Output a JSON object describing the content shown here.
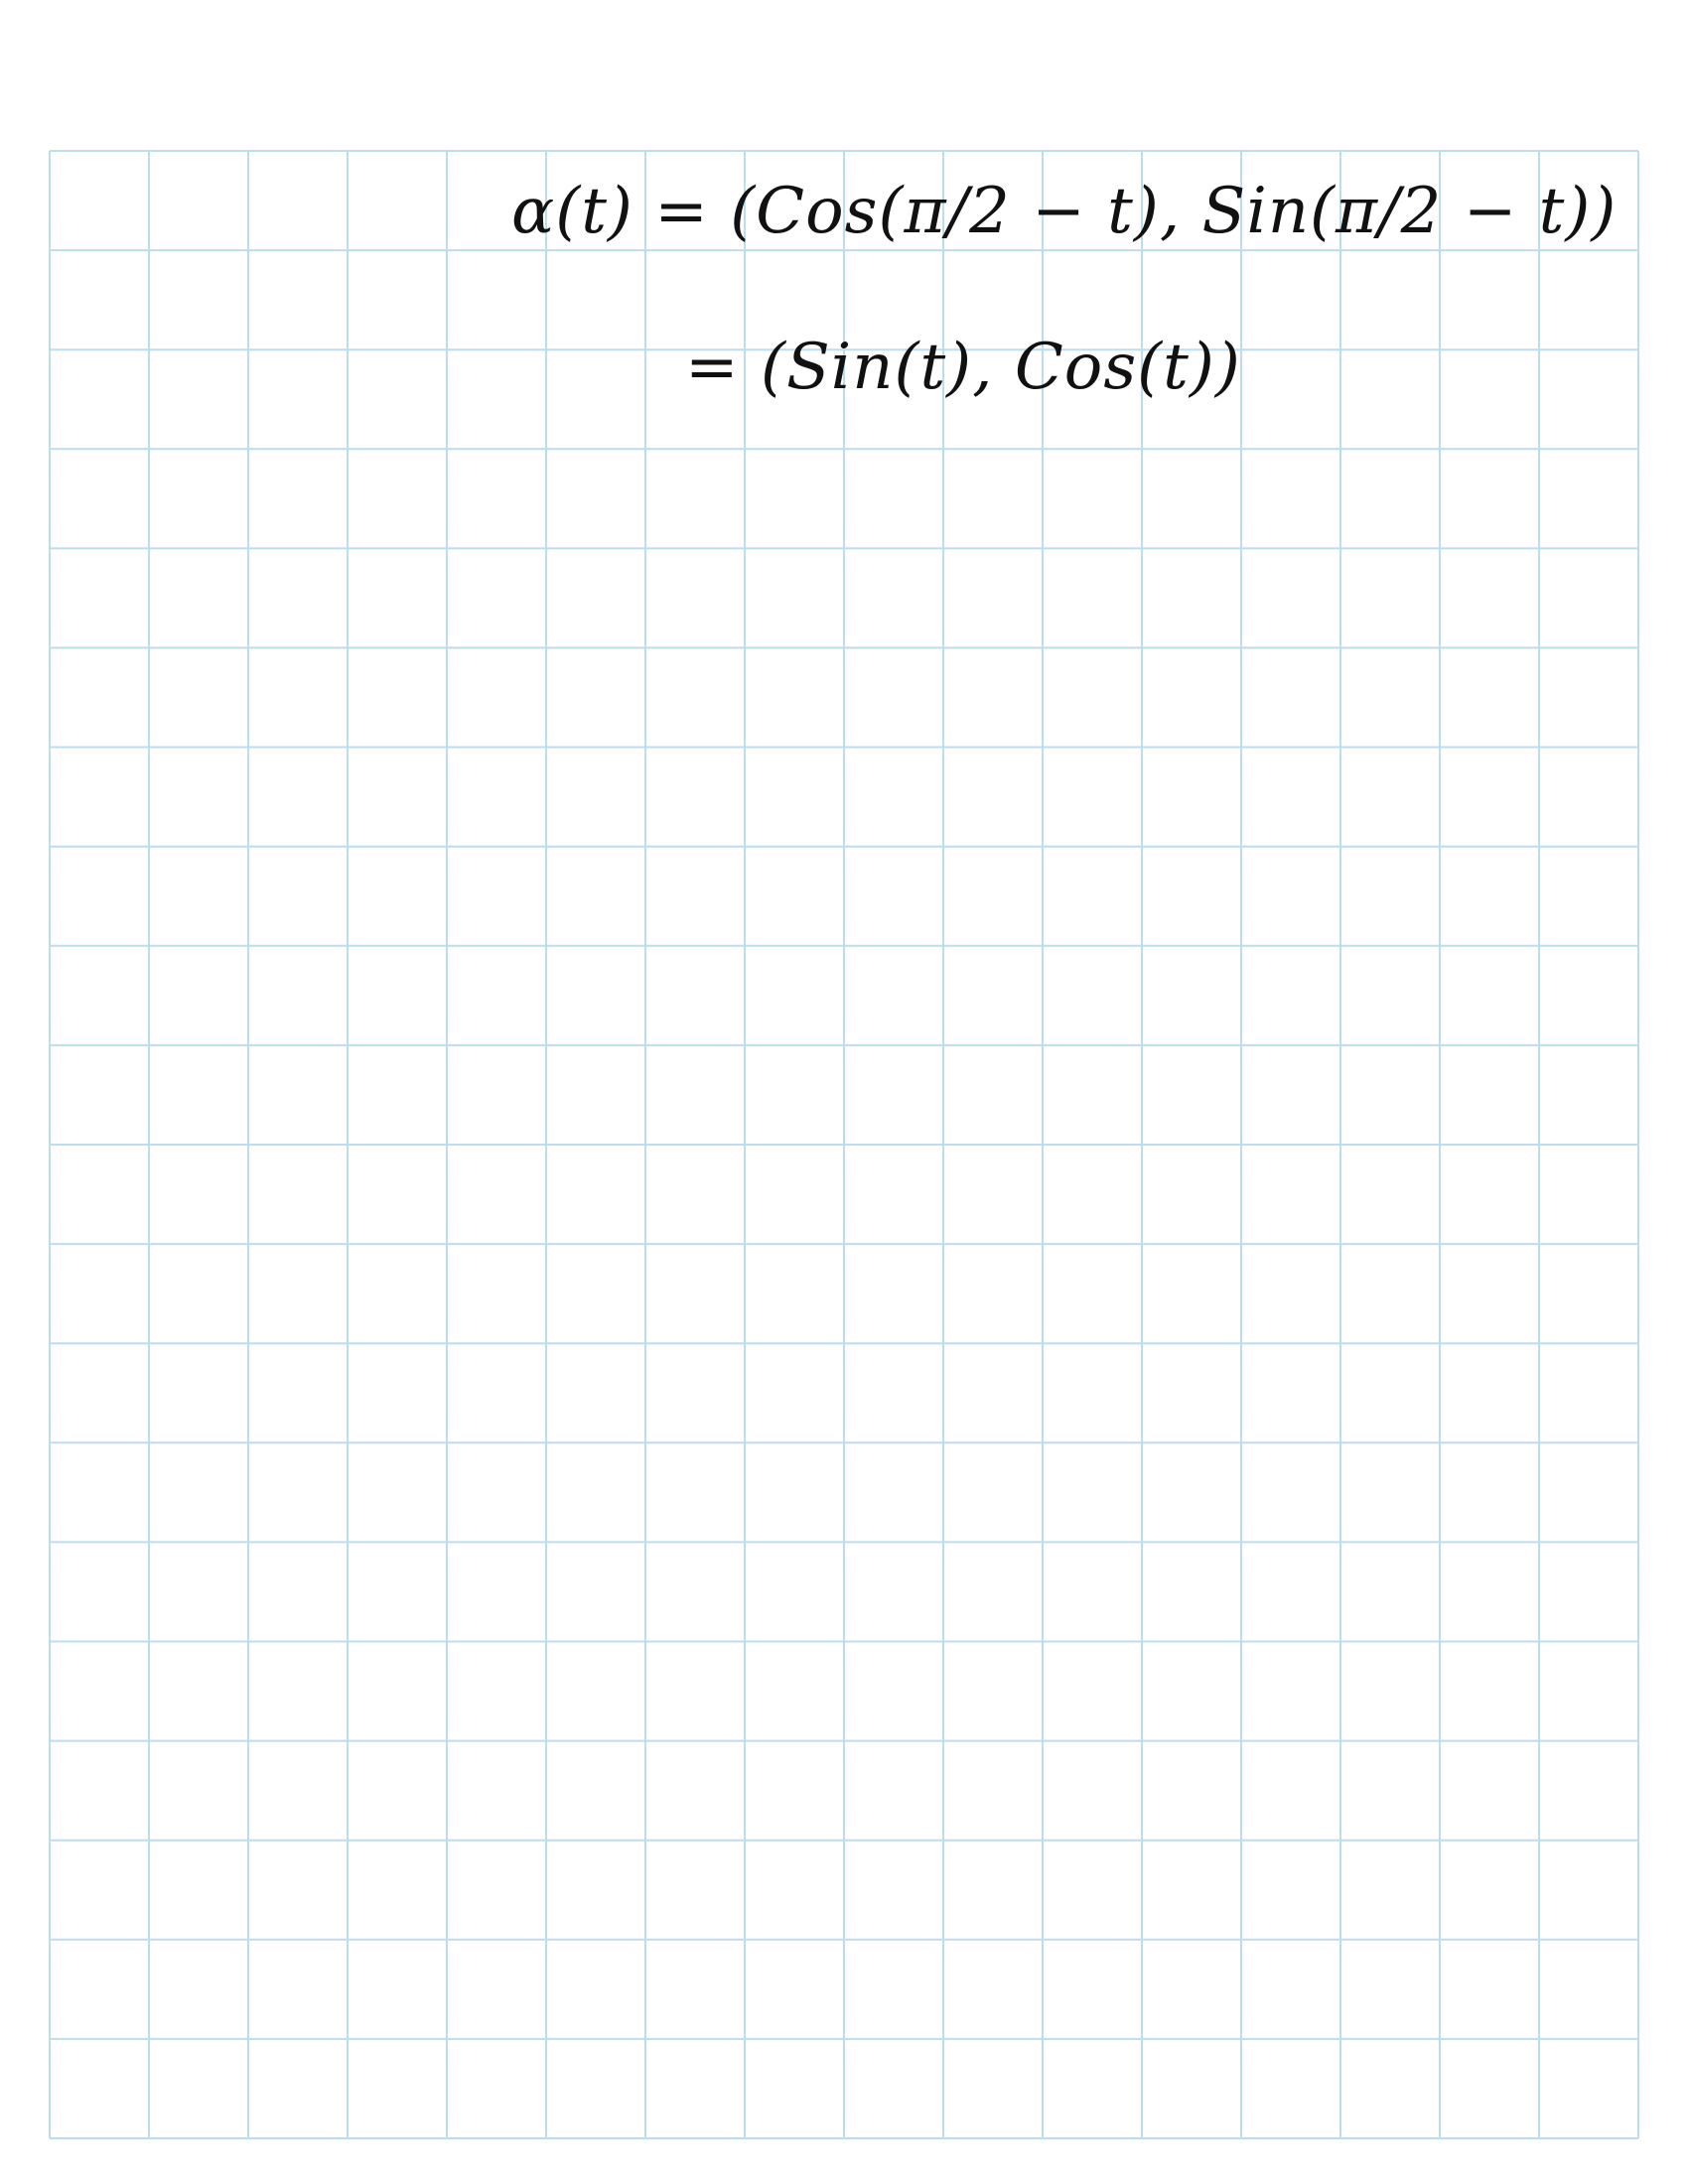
{
  "note": {
    "grid_color": "#bcdcef",
    "ink_color": "#111111",
    "lines": [
      "α(t) = (Cos(π/2 − t), Sin(π/2 − t))",
      "= (Sin(t), Cos(t))"
    ]
  }
}
